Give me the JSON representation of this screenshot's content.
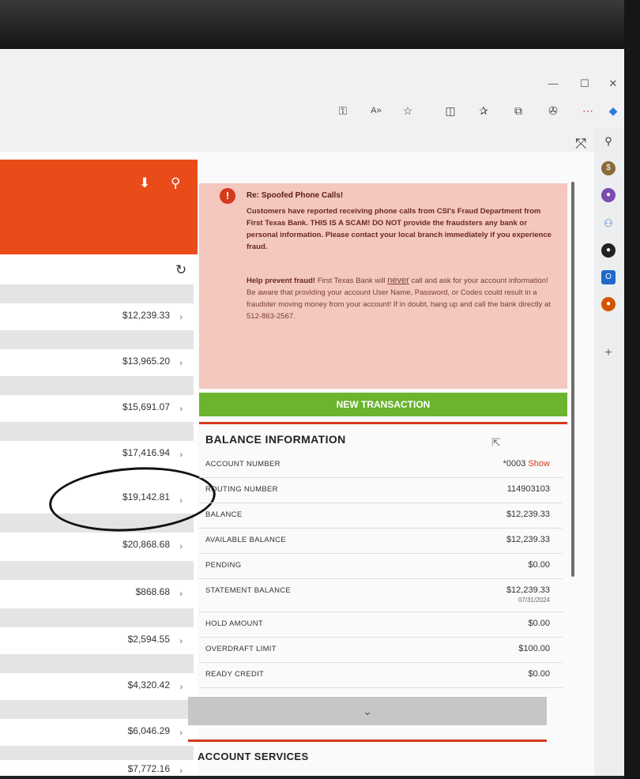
{
  "transactions": [
    {
      "amount": "$12,239.33"
    },
    {
      "amount": "$13,965.20"
    },
    {
      "amount": "$15,691.07"
    },
    {
      "amount": "$17,416.94"
    },
    {
      "amount": "$19,142.81"
    },
    {
      "amount": "$20,868.68"
    },
    {
      "amount": "$868.68"
    },
    {
      "amount": "$2,594.55"
    },
    {
      "amount": "$4,320.42"
    },
    {
      "amount": "$6,046.29"
    },
    {
      "amount": "$7,772.16"
    }
  ],
  "alert": {
    "title": "Re: Spoofed Phone Calls!",
    "body": "Customers have reported receiving phone calls from CSI's Fraud Department from First Texas Bank. THIS IS A SCAM! DO NOT provide the fraudsters any bank or personal information. Please contact your local branch immediately if you experience fraud.",
    "help_lead": "Help prevent fraud!",
    "help_pre": "First Texas Bank will",
    "help_never": "never",
    "help_post": "call and ask for your account information! Be aware that providing your account User Name, Password, or Codes could result in a fraudster moving money from your account! If in doubt, hang up and call the bank directly at 512-863-2567."
  },
  "new_transaction_label": "NEW TRANSACTION",
  "balance_information": {
    "title": "BALANCE INFORMATION",
    "rows": [
      {
        "label": "ACCOUNT NUMBER",
        "value": "*0003",
        "link": "Show"
      },
      {
        "label": "ROUTING NUMBER",
        "value": "114903103"
      },
      {
        "label": "BALANCE",
        "value": "$12,239.33"
      },
      {
        "label": "AVAILABLE BALANCE",
        "value": "$12,239.33"
      },
      {
        "label": "PENDING",
        "value": "$0.00"
      },
      {
        "label": "STATEMENT BALANCE",
        "value": "$12,239.33",
        "sub": "07/31/2024"
      },
      {
        "label": "HOLD AMOUNT",
        "value": "$0.00"
      },
      {
        "label": "OVERDRAFT LIMIT",
        "value": "$100.00"
      },
      {
        "label": "READY CREDIT",
        "value": "$0.00"
      }
    ]
  },
  "account_services_title": "ACCOUNT SERVICES",
  "icons": {
    "toolbar": [
      "key-icon",
      "read-aloud-icon",
      "favorite-star-icon",
      "split-screen-icon",
      "favorites-icon",
      "collections-icon",
      "extensions-icon",
      "games-icon",
      "copilot-icon"
    ],
    "sidebar": [
      "search-icon",
      "shopping-icon",
      "tools-icon",
      "people-icon",
      "games-icon",
      "outlook-icon",
      "office-icon",
      "add-icon"
    ]
  },
  "colors": {
    "brand_orange": "#ea4c19",
    "alert_bg": "#f4c7bf",
    "action_green": "#6ab42e",
    "accent_red": "#d33a1c"
  }
}
